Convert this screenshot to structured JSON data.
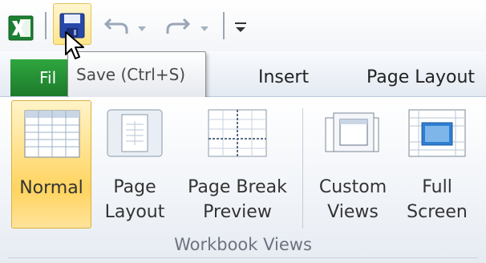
{
  "quick_access": {
    "app_icon": "excel-icon",
    "save_icon": "save-icon",
    "undo_icon": "undo-icon",
    "redo_icon": "redo-icon",
    "customize_icon": "customize-toolbar-icon"
  },
  "tooltip": {
    "text": "Save (Ctrl+S)"
  },
  "tabs": {
    "file": "Fil",
    "insert": "Insert",
    "page_layout": "Page Layout"
  },
  "workbook_views": {
    "group_label": "Workbook Views",
    "buttons": [
      {
        "label": "Normal",
        "icon": "normal-view-icon",
        "selected": true
      },
      {
        "label": "Page\nLayout",
        "icon": "page-layout-icon"
      },
      {
        "label": "Page Break\nPreview",
        "icon": "page-break-icon"
      },
      {
        "label": "Custom\nViews",
        "icon": "custom-views-icon"
      },
      {
        "label": "Full\nScreen",
        "icon": "full-screen-icon"
      }
    ]
  },
  "colors": {
    "file_tab": "#1f8a32",
    "selected_button": "#ffd45f",
    "save_highlight": "#ffe58a"
  }
}
